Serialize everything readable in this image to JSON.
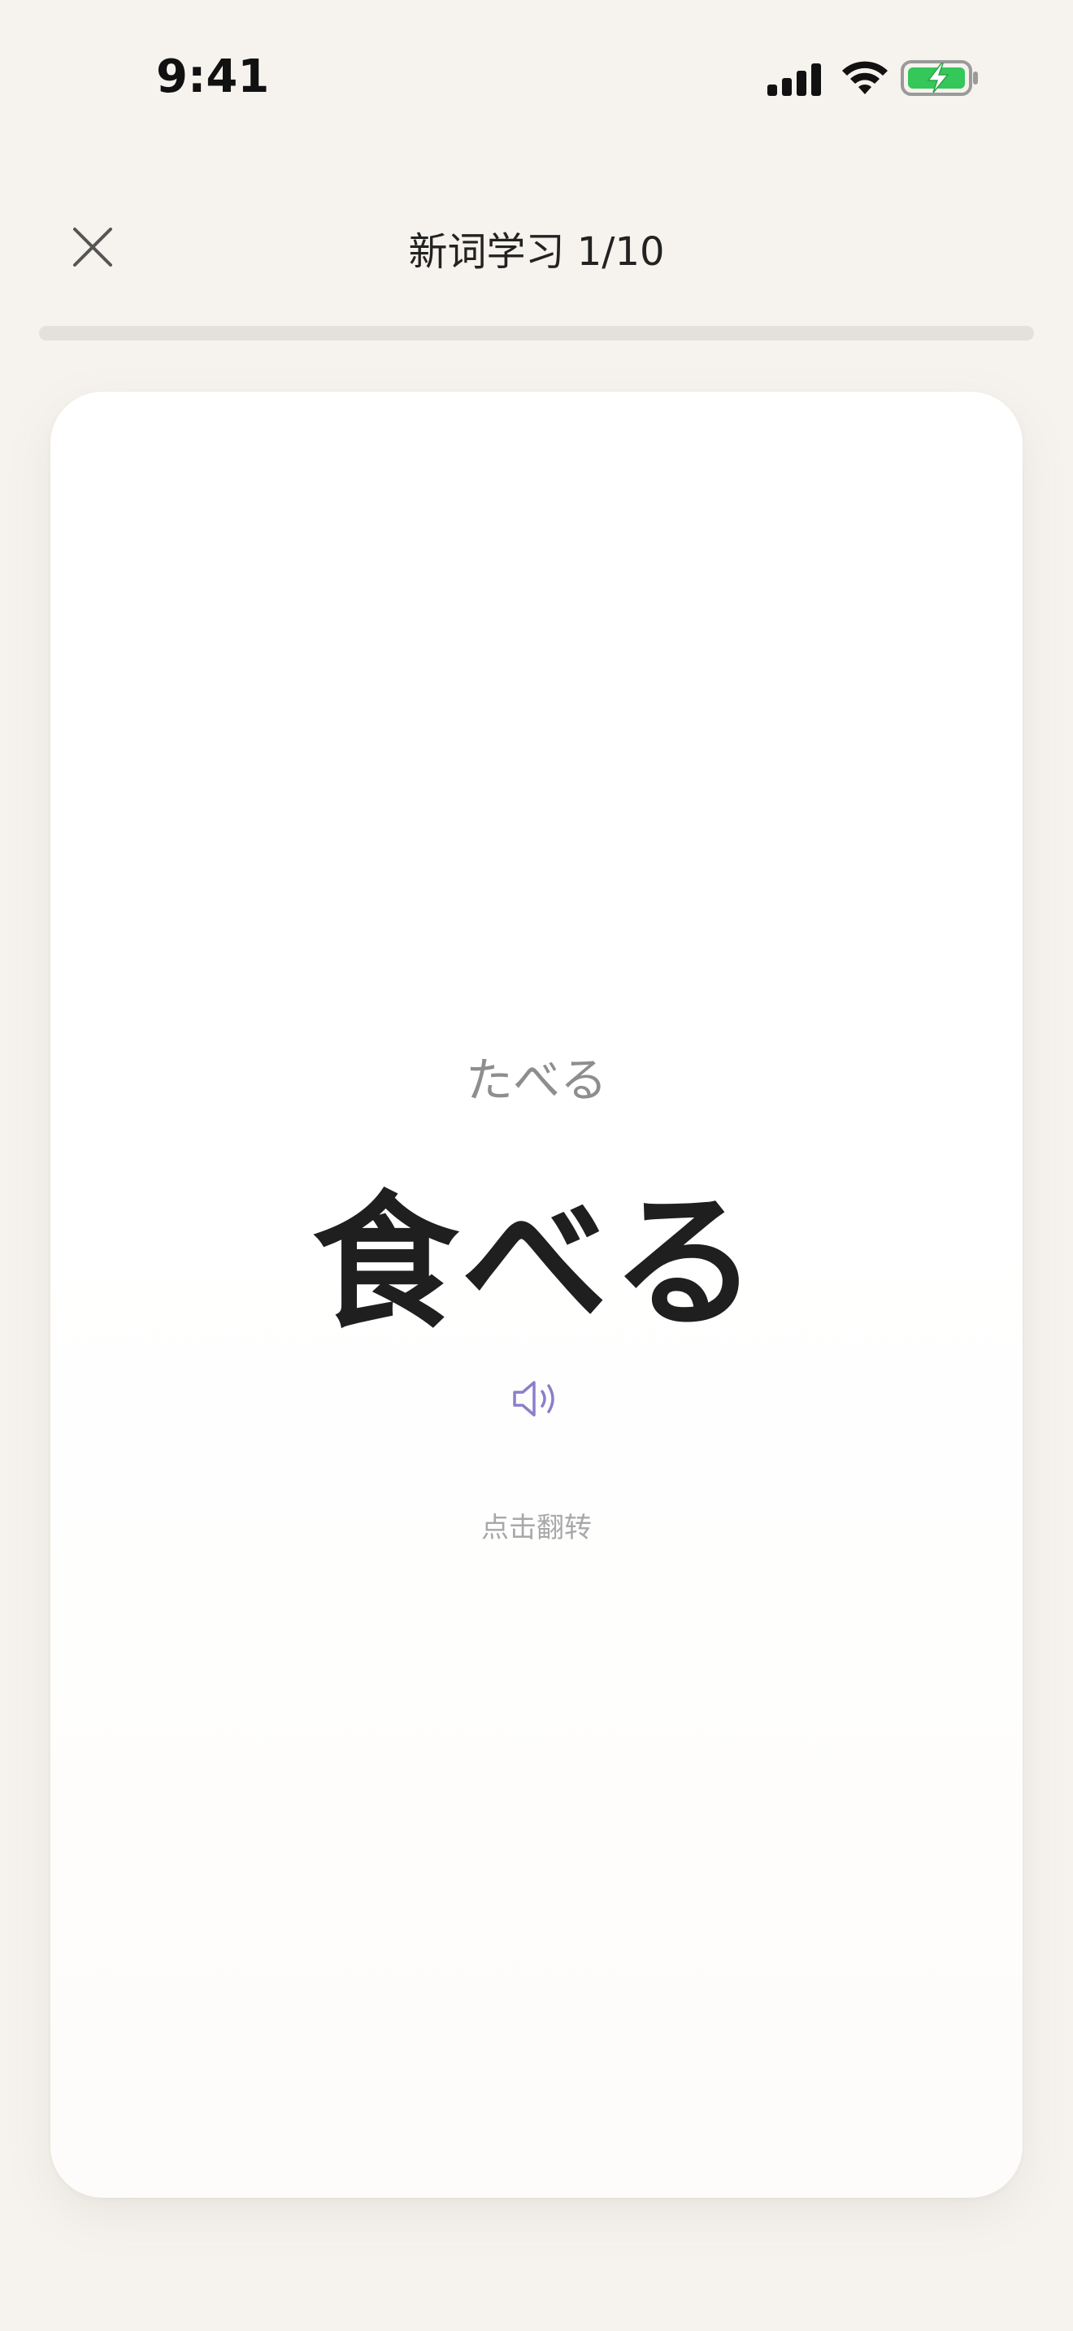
{
  "status_bar": {
    "time": "9:41",
    "icons": [
      "cellular-signal-icon",
      "wifi-icon",
      "battery-charging-icon"
    ],
    "battery_color": "#34c759"
  },
  "header": {
    "close_icon": "close-icon",
    "title": "新词学习 1/10"
  },
  "progress": {
    "current": 1,
    "total": 10,
    "fraction": 0.0
  },
  "card": {
    "reading": "たべる",
    "word": "食べる",
    "audio_icon": "speaker-icon",
    "hint": "点击翻转"
  },
  "colors": {
    "background": "#f6f3ee",
    "card": "#ffffff",
    "accent": "#8a7fc8",
    "text_primary": "#1f1f1f",
    "text_secondary": "#8e8e8e"
  }
}
